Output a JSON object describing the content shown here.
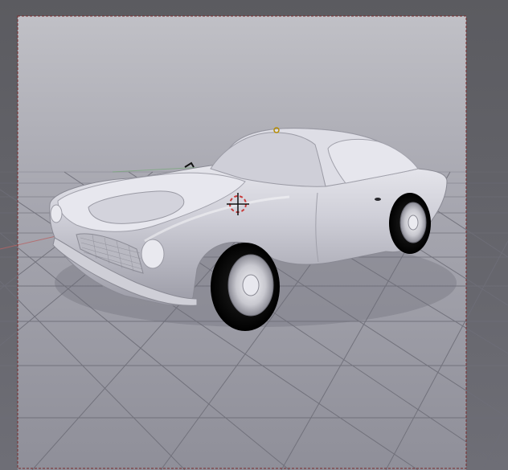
{
  "viewport": {
    "name": "3D viewport",
    "background_top": "#b7b7bd",
    "background_bottom": "#8e8e97",
    "grid_color": "#6a6a73",
    "frame_color": "#6b2a2a",
    "axis_x_color": "#a85a5a",
    "axis_y_color": "#6aa06a"
  },
  "scene": {
    "object": "car",
    "camera_frame": "visible",
    "3d_cursor": "visible"
  },
  "icons": {
    "cursor": "3d-cursor-icon",
    "object_origin": "object-origin-icon",
    "lamp": "lamp-icon"
  }
}
